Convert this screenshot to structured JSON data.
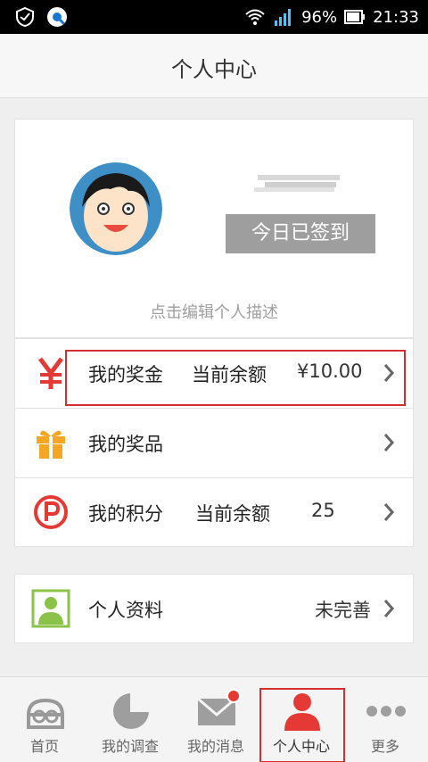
{
  "status_bar": {
    "battery": "96%",
    "time": "21:33"
  },
  "header": {
    "title": "个人中心"
  },
  "profile": {
    "signin_label": "今日已签到",
    "description_placeholder": "点击编辑个人描述"
  },
  "menu": {
    "bonus": {
      "label": "我的奖金",
      "balance_label": "当前余额",
      "balance_value": "¥10.00"
    },
    "prizes": {
      "label": "我的奖品"
    },
    "points": {
      "label": "我的积分",
      "balance_label": "当前余额",
      "balance_value": "25"
    },
    "profile_info": {
      "label": "个人资料",
      "status": "未完善"
    }
  },
  "tabs": [
    {
      "label": "首页"
    },
    {
      "label": "我的调查"
    },
    {
      "label": "我的消息"
    },
    {
      "label": "个人中心"
    },
    {
      "label": "更多"
    }
  ],
  "colors": {
    "accent_red": "#e53935",
    "gift_orange": "#f5a623",
    "profile_green": "#8bc34a",
    "avatar_blue": "#3d8fc6"
  },
  "icons": {
    "status_left": [
      "shield-check-icon",
      "q-app-icon"
    ],
    "status_right": [
      "wifi-icon",
      "signal-icon",
      "battery-icon"
    ],
    "menu": [
      "yen-icon",
      "gift-icon",
      "points-p-icon",
      "person-card-icon"
    ],
    "tabs": [
      "home-icon",
      "survey-pie-icon",
      "message-envelope-icon",
      "person-icon",
      "more-dots-icon"
    ]
  }
}
